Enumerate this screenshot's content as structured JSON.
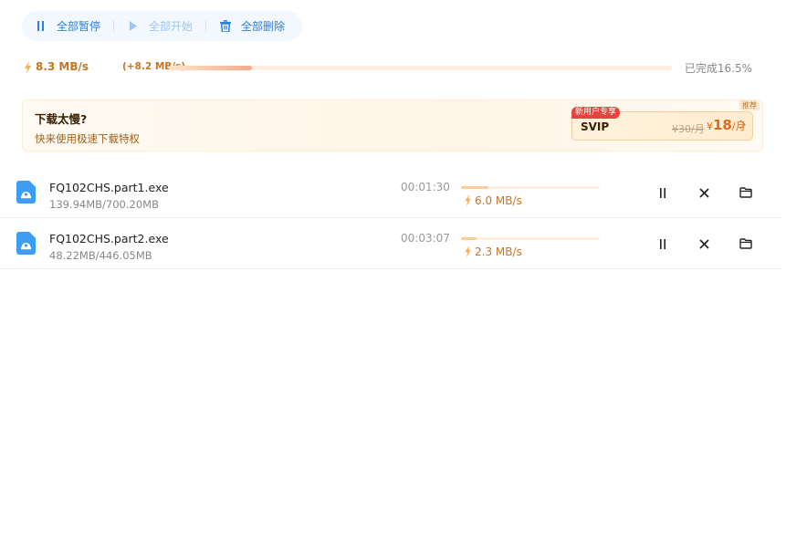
{
  "toolbar": {
    "pause_all": "全部暂停",
    "start_all": "全部开始",
    "delete_all": "全部删除"
  },
  "speed": {
    "current": "8.3 MB/s",
    "boost": "(+8.2 MB/s)",
    "progress_percent": 16.5,
    "done_label": "已完成16.5%"
  },
  "promo": {
    "title": "下载太慢?",
    "subtitle": "快来使用极速下载特权",
    "tag": "推荐",
    "badge": "新用户专享",
    "plan": "SVIP",
    "old_price": "¥30/月",
    "new_price_prefix": "¥",
    "new_price": "18",
    "new_price_unit": "/月"
  },
  "downloads": [
    {
      "name": "FQ102CHS.part1.exe",
      "size": "139.94MB/700.20MB",
      "time": "00:01:30",
      "speed": "6.0 MB/s",
      "progress_percent": 20
    },
    {
      "name": "FQ102CHS.part2.exe",
      "size": "48.22MB/446.05MB",
      "time": "00:03:07",
      "speed": "2.3 MB/s",
      "progress_percent": 11
    }
  ],
  "colors": {
    "accent_blue": "#2a7fe0",
    "speed_orange": "#c97424",
    "price_orange": "#e06a1a",
    "badge_red": "#e8443f",
    "file_icon_blue": "#3d9df2"
  },
  "icons": {
    "pause_all": "pause-icon",
    "start_all": "play-icon",
    "delete_all": "trash-icon",
    "speed": "lightning-icon",
    "file": "file-icon",
    "row_pause": "pause-icon",
    "row_cancel": "close-icon",
    "row_folder": "folder-icon"
  }
}
